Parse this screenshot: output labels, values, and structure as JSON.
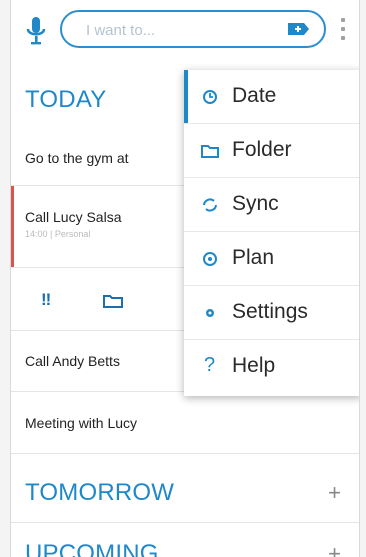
{
  "search": {
    "placeholder": "I want to..."
  },
  "sections": {
    "today": "TODAY",
    "tomorrow": "TOMORROW",
    "upcoming": "UPCOMING",
    "add_symbol": "+"
  },
  "tasks": [
    {
      "title": "Go to the gym at",
      "meta": ""
    },
    {
      "title": "Call Lucy Salsa",
      "meta": "14:00 | Personal"
    },
    {
      "title": "Call Andy Betts",
      "meta": ""
    },
    {
      "title": "Meeting with Lucy",
      "meta": ""
    }
  ],
  "task_actions": {
    "priority": "!!"
  },
  "menu": {
    "items": [
      {
        "label": "Date",
        "icon": "clock-icon"
      },
      {
        "label": "Folder",
        "icon": "folder-icon"
      },
      {
        "label": "Sync",
        "icon": "sync-icon"
      },
      {
        "label": "Plan",
        "icon": "plan-icon"
      },
      {
        "label": "Settings",
        "icon": "gear-icon"
      },
      {
        "label": "Help",
        "icon": "help-icon"
      }
    ]
  },
  "colors": {
    "accent": "#1f88c9",
    "selected_task": "#d9534f"
  }
}
